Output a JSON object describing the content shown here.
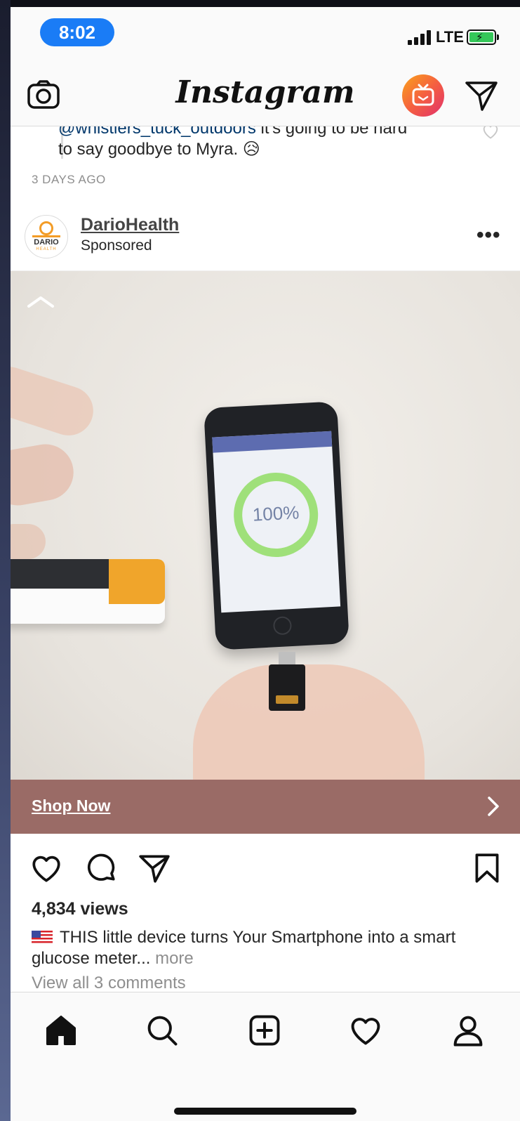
{
  "status_bar": {
    "time": "8:02",
    "network": "LTE",
    "battery_color": "#35c759"
  },
  "top_nav": {
    "logo": "Instagram",
    "icons": [
      "camera-icon",
      "igtv-icon",
      "direct-message-icon"
    ]
  },
  "previous_post": {
    "comment_mention": "@whistlers_tuck_outdoors",
    "comment_text_line1": " it's going to be hard",
    "comment_text_line2": "to say goodbye to Myra. 😥",
    "timestamp": "3 DAYS AGO"
  },
  "post": {
    "username": "DarioHealth",
    "sponsored_label": "Sponsored",
    "avatar_text": "DARIO",
    "avatar_subtext": "HEALTH",
    "media": {
      "phone_screen_percent": "100%",
      "brand_color": "#f39c26"
    },
    "cta": {
      "label": "Shop Now",
      "background": "#9a6b66"
    },
    "views": "4,834 views",
    "caption_text": "THIS little device turns Your Smartphone into a smart glucose meter...",
    "caption_more": " more",
    "view_comments": "View all 3 comments"
  },
  "bottom_nav": {
    "items": [
      "home-icon",
      "search-icon",
      "new-post-icon",
      "activity-icon",
      "profile-icon"
    ]
  }
}
